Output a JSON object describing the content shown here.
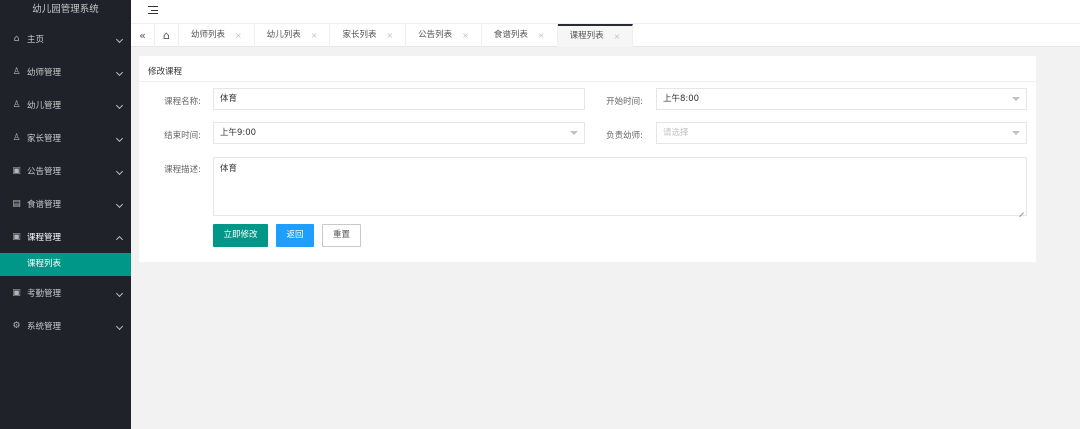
{
  "app": {
    "title": "幼儿园管理系统"
  },
  "sidebar": {
    "items": [
      {
        "label": "主页",
        "icon": "⌂"
      },
      {
        "label": "幼师管理",
        "icon": "♙"
      },
      {
        "label": "幼儿管理",
        "icon": "♙"
      },
      {
        "label": "家长管理",
        "icon": "♙"
      },
      {
        "label": "公告管理",
        "icon": "▣"
      },
      {
        "label": "食谱管理",
        "icon": "▤"
      },
      {
        "label": "课程管理",
        "icon": "▣"
      },
      {
        "label": "考勤管理",
        "icon": "▣"
      },
      {
        "label": "系统管理",
        "icon": "⚙"
      }
    ],
    "submenu": {
      "label": "课程列表"
    }
  },
  "tabs": [
    {
      "label": "幼师列表",
      "close": "×"
    },
    {
      "label": "幼儿列表",
      "close": "×"
    },
    {
      "label": "家长列表",
      "close": "×"
    },
    {
      "label": "公告列表",
      "close": "×"
    },
    {
      "label": "食谱列表",
      "close": "×"
    },
    {
      "label": "课程列表",
      "close": "×"
    }
  ],
  "tab_controls": {
    "back": "«",
    "home": "⌂"
  },
  "form": {
    "title": "修改课程",
    "course_name": {
      "label": "课程名称:",
      "value": "体育"
    },
    "start_time": {
      "label": "开始时间:",
      "value": "上午8:00"
    },
    "end_time": {
      "label": "结束时间:",
      "value": "上午9:00"
    },
    "teacher": {
      "label": "负责幼师:",
      "placeholder": "请选择"
    },
    "description": {
      "label": "课程描述:",
      "value": "体育"
    }
  },
  "buttons": {
    "submit": "立即修改",
    "back": "返回",
    "reset": "重置"
  },
  "colors": {
    "sidebar_bg": "#20222a",
    "accent": "#009688",
    "blue": "#1E9FFF"
  }
}
